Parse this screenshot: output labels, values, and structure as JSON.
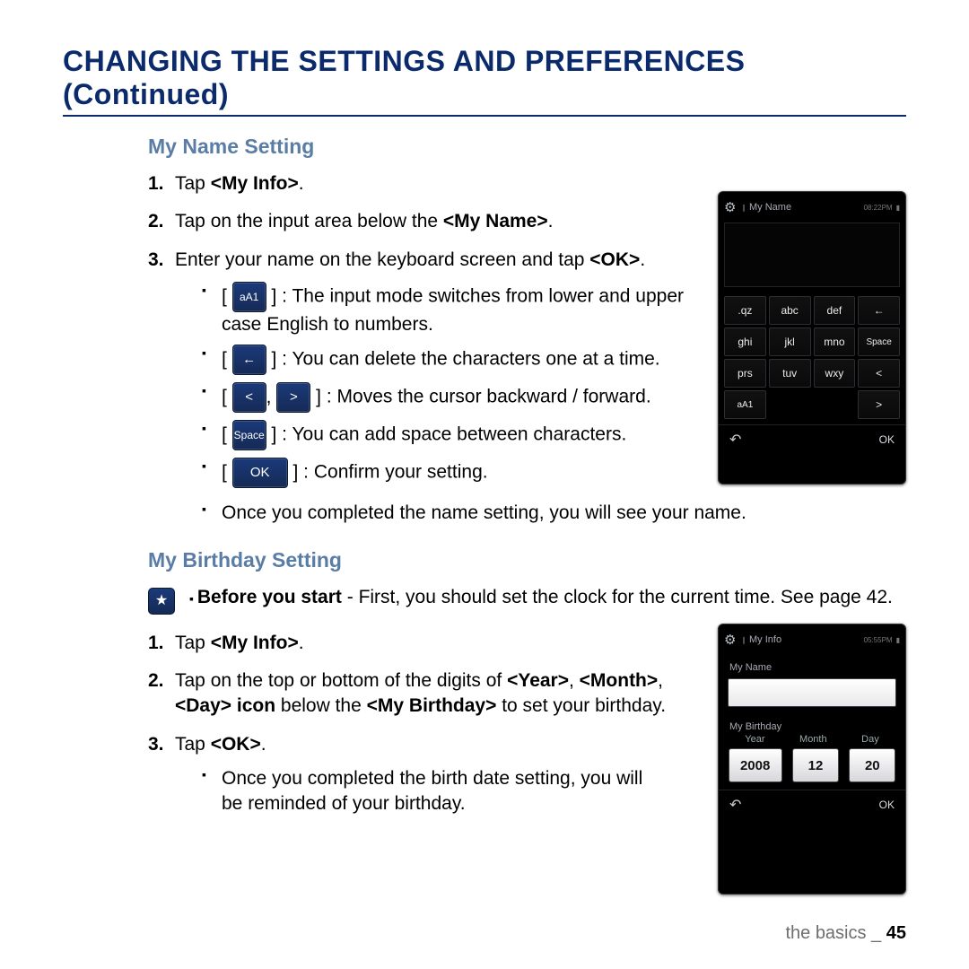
{
  "title": "CHANGING THE SETTINGS AND PREFERENCES (Continued)",
  "section1": {
    "heading": "My Name Setting",
    "steps": [
      {
        "num": "1.",
        "pre": "Tap ",
        "bold": "<My Info>",
        "post": "."
      },
      {
        "num": "2.",
        "pre": "Tap on the input area below the ",
        "bold": "<My Name>",
        "post": "."
      },
      {
        "num": "3.",
        "pre": "Enter your name on the keyboard screen and tap ",
        "bold": "<OK>",
        "post": "."
      }
    ],
    "bullets": {
      "aA1_text": " : The input mode switches from lower and upper case English to numbers.",
      "del_text": " : You can delete the characters one at a time.",
      "nav_text": " : Moves the cursor backward / forward.",
      "space_text": " : You can add space between characters.",
      "ok_text": " : Confirm your setting.",
      "done": "Once you completed the name setting, you will see your name."
    },
    "chips": {
      "aA1": "aA1",
      "back": "←",
      "left": "<",
      "right": ">",
      "space": "Space",
      "ok": "OK",
      "sep": ", "
    }
  },
  "section2": {
    "heading": "My Birthday Setting",
    "note_lead": "Before you start",
    "note_rest": " - First, you should set the clock for the current time. See page 42.",
    "steps": {
      "s1": {
        "num": "1.",
        "pre": "Tap ",
        "bold": "<My Info>",
        "post": "."
      },
      "s2": {
        "num": "2.",
        "pre": "Tap on the top or bottom of the digits of ",
        "b1": "<Year>",
        "mid1": ", ",
        "b2": "<Month>",
        "mid2": ", ",
        "b3": "<Day> icon",
        "mid3": " below the ",
        "b4": "<My Birthday>",
        "post": " to set your birthday."
      },
      "s3": {
        "num": "3.",
        "pre": "Tap ",
        "bold": "<OK>",
        "post": "."
      }
    },
    "bullet": "Once you completed the birth date setting, you will be reminded of your birthday."
  },
  "device1": {
    "title": "My Name",
    "time": "08:22PM",
    "keys": [
      ".qz",
      "abc",
      "def",
      "←",
      "ghi",
      "jkl",
      "mno",
      "Space",
      "prs",
      "tuv",
      "wxy",
      "<",
      "aA1",
      "",
      "",
      ">"
    ],
    "ok": "OK"
  },
  "device2": {
    "title": "My Info",
    "time": "05:55PM",
    "name_label": "My Name",
    "bday_label": "My Birthday",
    "cols": {
      "y": "Year",
      "m": "Month",
      "d": "Day"
    },
    "vals": {
      "y": "2008",
      "m": "12",
      "d": "20"
    },
    "ok": "OK"
  },
  "footer": {
    "section": "the basics _ ",
    "page": "45"
  }
}
